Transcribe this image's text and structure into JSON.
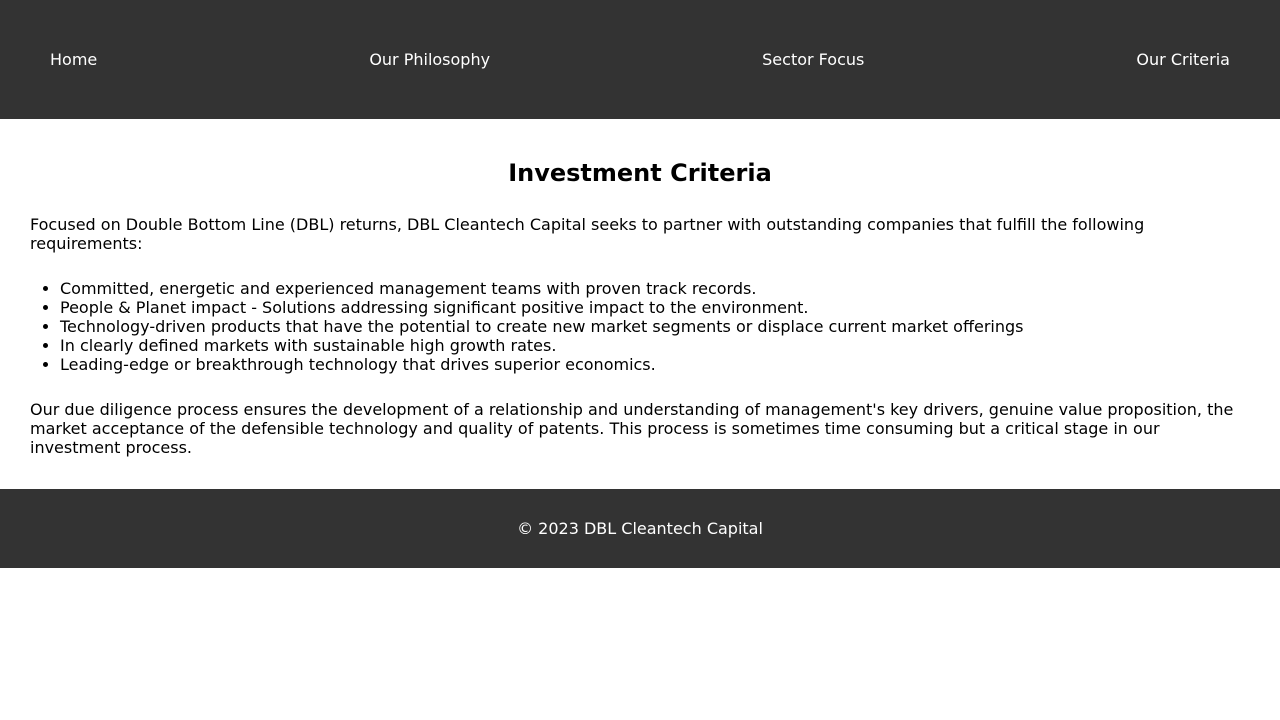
{
  "nav": {
    "items": [
      {
        "label": "Home"
      },
      {
        "label": "Our Philosophy"
      },
      {
        "label": "Sector Focus"
      },
      {
        "label": "Our Criteria"
      }
    ]
  },
  "main": {
    "title": "Investment Criteria",
    "intro": "Focused on Double Bottom Line (DBL) returns, DBL Cleantech Capital seeks to partner with outstanding companies that fulfill the following requirements:",
    "criteria": [
      "Committed, energetic and experienced management teams with proven track records.",
      "People & Planet impact - Solutions addressing significant positive impact to the environment.",
      "Technology-driven products that have the potential to create new market segments or displace current market offerings",
      "In clearly defined markets with sustainable high growth rates.",
      "Leading-edge or breakthrough technology that drives superior economics."
    ],
    "closing": "Our due diligence process ensures the development of a relationship and understanding of management's key drivers, genuine value proposition, the market acceptance of the defensible technology and quality of patents. This process is sometimes time consuming but a critical stage in our investment process."
  },
  "footer": {
    "text": "© 2023 DBL Cleantech Capital"
  },
  "colors": {
    "nav_background": "#333333",
    "footer_background": "#333333",
    "nav_text": "#ffffff",
    "body_text": "#000000",
    "page_background": "#ffffff"
  }
}
